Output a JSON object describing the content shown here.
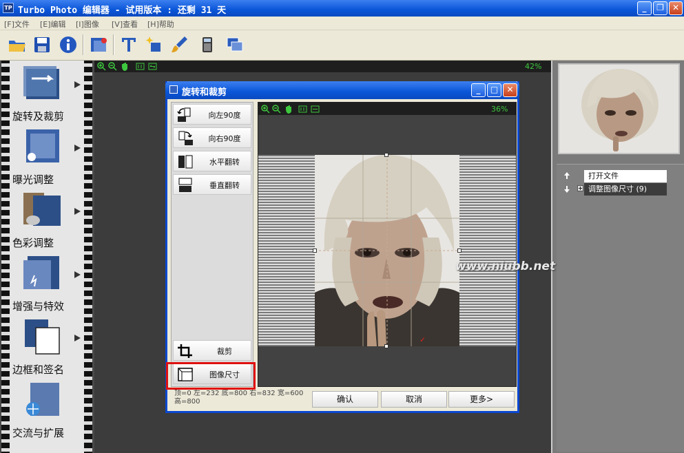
{
  "window": {
    "title": "Turbo Photo 编辑器 - 试用版本 : 还剩 31 天",
    "app_icon_text": "TP"
  },
  "menu": [
    "[F]文件",
    "[E]编辑",
    "[I]图像",
    "[V]查看",
    "[H]帮助"
  ],
  "toolbar": {
    "buttons": [
      "open-folder-icon",
      "save-icon",
      "info-icon",
      "batch-icon",
      "text-icon",
      "sparkle-icon",
      "brush-icon",
      "calculator-icon",
      "windows-icon"
    ]
  },
  "left_tools": [
    {
      "label": "旋转及裁剪",
      "icon": "rotate-crop-icon"
    },
    {
      "label": "曝光调整",
      "icon": "exposure-icon"
    },
    {
      "label": "色彩调整",
      "icon": "color-icon"
    },
    {
      "label": "增强与特效",
      "icon": "enhance-icon"
    },
    {
      "label": "边框和签名",
      "icon": "frame-icon"
    },
    {
      "label": "交流与扩展",
      "icon": "share-icon"
    }
  ],
  "main": {
    "zoom_percent": "42%"
  },
  "history": {
    "items": [
      "打开文件",
      "调整图像尺寸 (9)"
    ]
  },
  "dialog": {
    "title": "旋转和裁剪",
    "options": [
      "向左90度",
      "向右90度",
      "水平翻转",
      "垂直翻转"
    ],
    "bottom_options": [
      "裁剪",
      "图像尺寸"
    ],
    "zoom_percent": "36%",
    "status": "顶=0 左=232 底=800 右=832 宽=600 高=800",
    "buttons": {
      "ok": "确认",
      "cancel": "取消",
      "more": "更多>"
    },
    "watermark": "www.niubb.net"
  },
  "colors": {
    "xp_blue": "#0a55d8",
    "highlight": "#e01010",
    "zoom_green": "#3ec83e"
  }
}
